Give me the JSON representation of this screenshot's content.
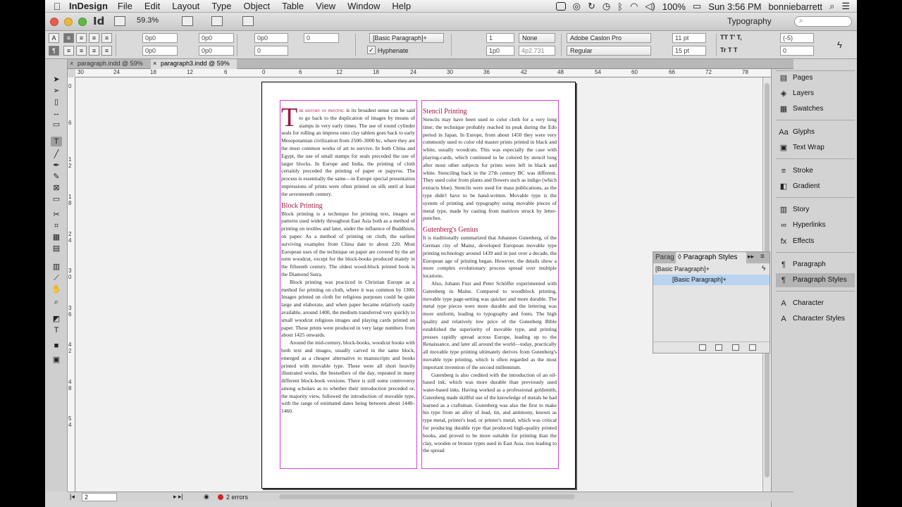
{
  "menubar": {
    "app_name": "InDesign",
    "menus": [
      "File",
      "Edit",
      "Layout",
      "Type",
      "Object",
      "Table",
      "View",
      "Window",
      "Help"
    ],
    "battery": "100%",
    "clock": "Sun 3:56 PM",
    "user": "bonniebarrett"
  },
  "appbar": {
    "logo": "Id",
    "zoom": "59.3%",
    "workspace": "Typography",
    "search_placeholder": "⌕"
  },
  "control": {
    "indent_left": "0p0",
    "indent_right": "0p0",
    "first_line_indent": "0p0",
    "last_line_indent": "0p0",
    "space_before": "0p0",
    "space_after": "0",
    "space_before_2": "0",
    "paragraph_style": "[Basic Paragraph]+",
    "hyphenate_label": "Hyphenate",
    "drop_cap_lines": "1",
    "drop_cap_chars": "1p0",
    "align_to": "None",
    "baseline": "4p2.731",
    "font_family": "Adobe Caslon Pro",
    "font_style": "Regular",
    "font_size": "11 pt",
    "leading": "15 pt",
    "tracking": "(-5)",
    "kerning": "0"
  },
  "tabs": [
    {
      "label": "paragraph.indd @ 59%"
    },
    {
      "label": "paragraph3.indd @ 59%"
    }
  ],
  "ruler": {
    "h_labels": [
      "30",
      "24",
      "18",
      "12",
      "6",
      "0",
      "6",
      "12",
      "18",
      "24",
      "30",
      "36",
      "42",
      "48",
      "54",
      "60",
      "66",
      "72",
      "78"
    ],
    "v_labels": [
      "0",
      "6",
      "1 2",
      "1 8",
      "2 4",
      "3 0",
      "3 6",
      "4 2",
      "4 8",
      "5 4"
    ]
  },
  "document": {
    "left_column": {
      "dropcap": "T",
      "intro_smallcaps": "he history of printing",
      "intro_text": "is its broadest sense can be said to go back to the duplication of images by means of stamps in very early times. The use of round cylinder seals for rolling an impress onto clay tablets goes back to early Mesopotamian civilization from 2500–3000 bc, where they are the most common works of art to survive. In both China and Egypt, the use of small stamps for seals preceded the use of larger blocks. In Europe and India, the printing of cloth certainly preceded the printing of paper or papyrus. The process is essentially the same—in Europe special presentation impressions of prints were often printed on silk until at least the seventeenth century.",
      "heading1": "Block Printing",
      "para1": "Block printing is a technique for printing text, images or patterns used widely throughout East Asia both as a method of printing on textiles and later, under the influence of Buddhism, on paper. As a method of printing on cloth, the earliest surviving examples from China date to about 220. Most European uses of the technique on paper are covered by the art term woodcut, except for the block-books produced mainly in the fifteenth century. The oldest wood-block printed book is the Diamond Sutra.",
      "para2": "Block printing was practiced in Christian Europe as a method for printing on cloth, where it was common by 1300. Images printed on cloth for religious purposes could be quite large and elaborate, and when paper became relatively easily available, around 1400, the medium transferred very quickly to small woodcut religious images and playing cards printed on paper. These prints were produced in very large numbers from about 1425 onwards.",
      "para3": "Around the mid-century, block-books, woodcut books with both text and images, usually carved in the same block, emerged as a cheaper alternative to manuscripts and books printed with movable type. These were all short heavily illustrated works, the bestsellers of the day, repeated in many different block-book versions. There is still some controversy among scholars as to whether their introduction preceded or, the majority view, followed the introduction of movable type, with the range of estimated dates being between about 1440–1460."
    },
    "right_column": {
      "heading1": "Stencil Printing",
      "para1": "Stencils may have been used to color cloth for a very long time; the technique probably reached its peak during the Edo period in Japan. In Europe, from about 1450 they were very commonly used to color old master prints printed in black and white, usually woodcuts. This was especially the case with playing-cards, which continued to be colored by stencil long after most other subjects for prints were left in black and white. Stenciling back in the 27th century BC was different. They used color from plants and flowers such as indigo (which extracts blue). Stencils were used for mass publications, as the type didn't have to be hand-written. Movable type is the system of printing and typography using movable pieces of metal type, made by casting from matrices struck by letter-punches.",
      "heading2": "Gutenberg's Genius",
      "para2": "It is traditionally summarized that Johannes Gutenberg, of the German city of Mainz, developed European movable type printing technology around 1439 and in just over a decade, the European age of printing began. However, the details show a more complex evolutionary process spread over multiple locations.",
      "para3": "Also, Johann Fust and Peter Schöffer experimented with Gutenberg in Mainz. Compared to woodblock printing, movable type page-setting was quicker and more durable. The metal type pieces were more durable and the lettering was more uniform, leading to typography and fonts. The high quality and relatively low price of the Gutenberg Bible established the superiority of movable type, and printing presses rapidly spread across Europe, leading up to the Renaissance, and later all around the world—today, practically all movable type printing ultimately derives from Gutenberg's movable type printing, which is often regarded as the most important invention of the second millennium.",
      "para4": "Gutenberg is also credited with the introduction of an oil-based ink, which was more durable than previously used water-based inks. Having worked as a professional goldsmith, Gutenberg made skillful use of the knowledge of metals he had learned as a craftsman. Gutenberg was also the first to make his type from an alloy of lead, tin, and antimony, known as type metal, printer's lead, or printer's metal, which was critical for producing durable type that produced high-quality printed books, and proved to be more suitable for printing than the clay, wooden or bronze types used in East Asia. tion leading to the spread"
    }
  },
  "paragraph_styles_panel": {
    "tab_paragraph": "Parag",
    "tab_styles": "◊ Paragraph Styles",
    "current_style": "[Basic Paragraph]+",
    "styles": [
      "[Basic Paragraph]+"
    ]
  },
  "dock": {
    "items": [
      {
        "label": "Pages",
        "icon": "▤"
      },
      {
        "label": "Layers",
        "icon": "◈"
      },
      {
        "label": "Swatches",
        "icon": "▦"
      },
      {
        "label": "Glyphs",
        "icon": "Aa"
      },
      {
        "label": "Text Wrap",
        "icon": "▣"
      },
      {
        "label": "Stroke",
        "icon": "≡"
      },
      {
        "label": "Gradient",
        "icon": "◧"
      },
      {
        "label": "Story",
        "icon": "▥"
      },
      {
        "label": "Hyperlinks",
        "icon": "∞"
      },
      {
        "label": "Effects",
        "icon": "fx"
      },
      {
        "label": "Paragraph",
        "icon": "¶"
      },
      {
        "label": "Paragraph Styles",
        "icon": "¶"
      },
      {
        "label": "Character",
        "icon": "A"
      },
      {
        "label": "Character Styles",
        "icon": "A"
      }
    ]
  },
  "statusbar": {
    "page": "2",
    "errors": "2 errors"
  }
}
